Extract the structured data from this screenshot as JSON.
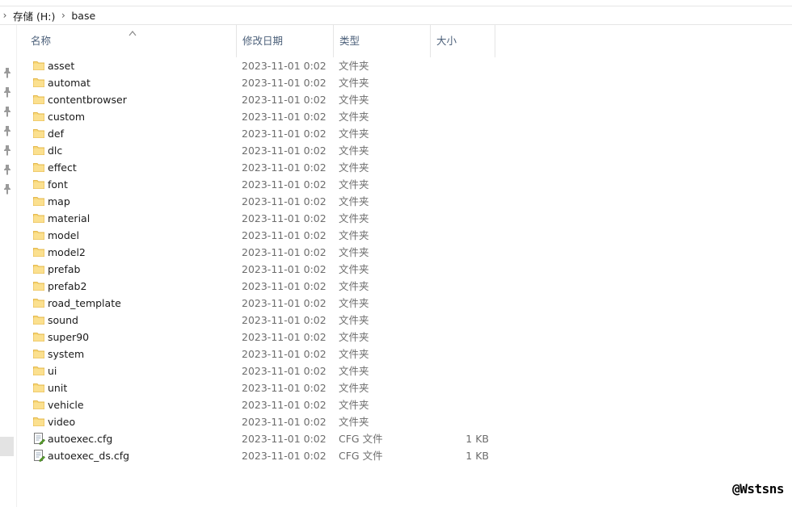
{
  "breadcrumb": {
    "items": [
      "存储 (H:)",
      "base"
    ]
  },
  "columns": {
    "name": "名称",
    "date": "修改日期",
    "type": "类型",
    "size": "大小"
  },
  "icons": {
    "folder": "folder-icon",
    "cfg": "cfg-file-icon",
    "pin": "pin-icon",
    "sort": "sort-ascending-icon"
  },
  "colors": {
    "folder": "#f8d775",
    "header_text": "#4c607a",
    "meta_text": "#6d6d6d"
  },
  "files": [
    {
      "name": "asset",
      "date": "2023-11-01 0:02",
      "type": "文件夹",
      "size": "",
      "kind": "folder"
    },
    {
      "name": "automat",
      "date": "2023-11-01 0:02",
      "type": "文件夹",
      "size": "",
      "kind": "folder"
    },
    {
      "name": "contentbrowser",
      "date": "2023-11-01 0:02",
      "type": "文件夹",
      "size": "",
      "kind": "folder"
    },
    {
      "name": "custom",
      "date": "2023-11-01 0:02",
      "type": "文件夹",
      "size": "",
      "kind": "folder"
    },
    {
      "name": "def",
      "date": "2023-11-01 0:02",
      "type": "文件夹",
      "size": "",
      "kind": "folder"
    },
    {
      "name": "dlc",
      "date": "2023-11-01 0:02",
      "type": "文件夹",
      "size": "",
      "kind": "folder"
    },
    {
      "name": "effect",
      "date": "2023-11-01 0:02",
      "type": "文件夹",
      "size": "",
      "kind": "folder"
    },
    {
      "name": "font",
      "date": "2023-11-01 0:02",
      "type": "文件夹",
      "size": "",
      "kind": "folder"
    },
    {
      "name": "map",
      "date": "2023-11-01 0:02",
      "type": "文件夹",
      "size": "",
      "kind": "folder"
    },
    {
      "name": "material",
      "date": "2023-11-01 0:02",
      "type": "文件夹",
      "size": "",
      "kind": "folder"
    },
    {
      "name": "model",
      "date": "2023-11-01 0:02",
      "type": "文件夹",
      "size": "",
      "kind": "folder"
    },
    {
      "name": "model2",
      "date": "2023-11-01 0:02",
      "type": "文件夹",
      "size": "",
      "kind": "folder"
    },
    {
      "name": "prefab",
      "date": "2023-11-01 0:02",
      "type": "文件夹",
      "size": "",
      "kind": "folder"
    },
    {
      "name": "prefab2",
      "date": "2023-11-01 0:02",
      "type": "文件夹",
      "size": "",
      "kind": "folder"
    },
    {
      "name": "road_template",
      "date": "2023-11-01 0:02",
      "type": "文件夹",
      "size": "",
      "kind": "folder"
    },
    {
      "name": "sound",
      "date": "2023-11-01 0:02",
      "type": "文件夹",
      "size": "",
      "kind": "folder"
    },
    {
      "name": "super90",
      "date": "2023-11-01 0:02",
      "type": "文件夹",
      "size": "",
      "kind": "folder"
    },
    {
      "name": "system",
      "date": "2023-11-01 0:02",
      "type": "文件夹",
      "size": "",
      "kind": "folder"
    },
    {
      "name": "ui",
      "date": "2023-11-01 0:02",
      "type": "文件夹",
      "size": "",
      "kind": "folder"
    },
    {
      "name": "unit",
      "date": "2023-11-01 0:02",
      "type": "文件夹",
      "size": "",
      "kind": "folder"
    },
    {
      "name": "vehicle",
      "date": "2023-11-01 0:02",
      "type": "文件夹",
      "size": "",
      "kind": "folder"
    },
    {
      "name": "video",
      "date": "2023-11-01 0:02",
      "type": "文件夹",
      "size": "",
      "kind": "folder"
    },
    {
      "name": "autoexec.cfg",
      "date": "2023-11-01 0:02",
      "type": "CFG 文件",
      "size": "1 KB",
      "kind": "cfg"
    },
    {
      "name": "autoexec_ds.cfg",
      "date": "2023-11-01 0:02",
      "type": "CFG 文件",
      "size": "1 KB",
      "kind": "cfg"
    }
  ],
  "watermark": "@Wstsns"
}
